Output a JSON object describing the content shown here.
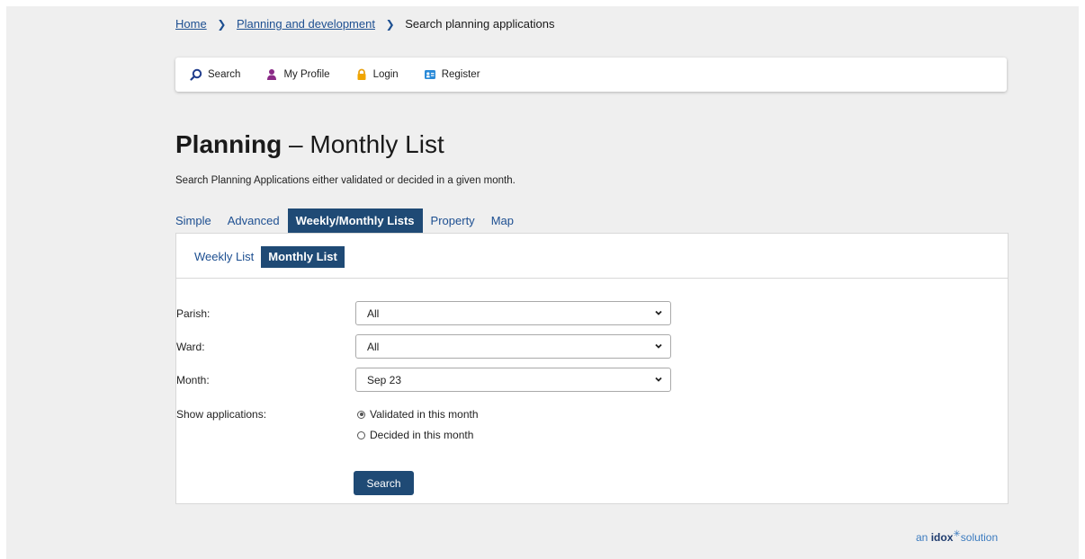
{
  "breadcrumb": {
    "home": "Home",
    "section": "Planning and development",
    "current": "Search planning applications"
  },
  "toolbar": {
    "search": "Search",
    "profile": "My Profile",
    "login": "Login",
    "register": "Register"
  },
  "page": {
    "title_bold": "Planning",
    "title_rest": " – Monthly List",
    "intro": "Search Planning Applications either validated or decided in a given month."
  },
  "tabs": [
    "Simple",
    "Advanced",
    "Weekly/Monthly Lists",
    "Property",
    "Map"
  ],
  "active_tab": "Weekly/Monthly Lists",
  "subtabs": [
    "Weekly List",
    "Monthly List"
  ],
  "active_subtab": "Monthly List",
  "form": {
    "parish_label": "Parish:",
    "parish_value": "All",
    "ward_label": "Ward:",
    "ward_value": "All",
    "month_label": "Month:",
    "month_value": "Sep 23",
    "show_label": "Show applications:",
    "option_validated": "Validated in this month",
    "option_decided": "Decided in this month",
    "selected_option": "validated",
    "search_button": "Search"
  },
  "footer": {
    "an": "an",
    "brand": "idox",
    "solution": "solution"
  },
  "colors": {
    "accent": "#1f4a75",
    "link": "#1d4f91",
    "background": "#efefef"
  },
  "icons": {
    "search": "search-icon",
    "profile": "user-icon",
    "login": "lock-icon",
    "register": "register-icon"
  }
}
